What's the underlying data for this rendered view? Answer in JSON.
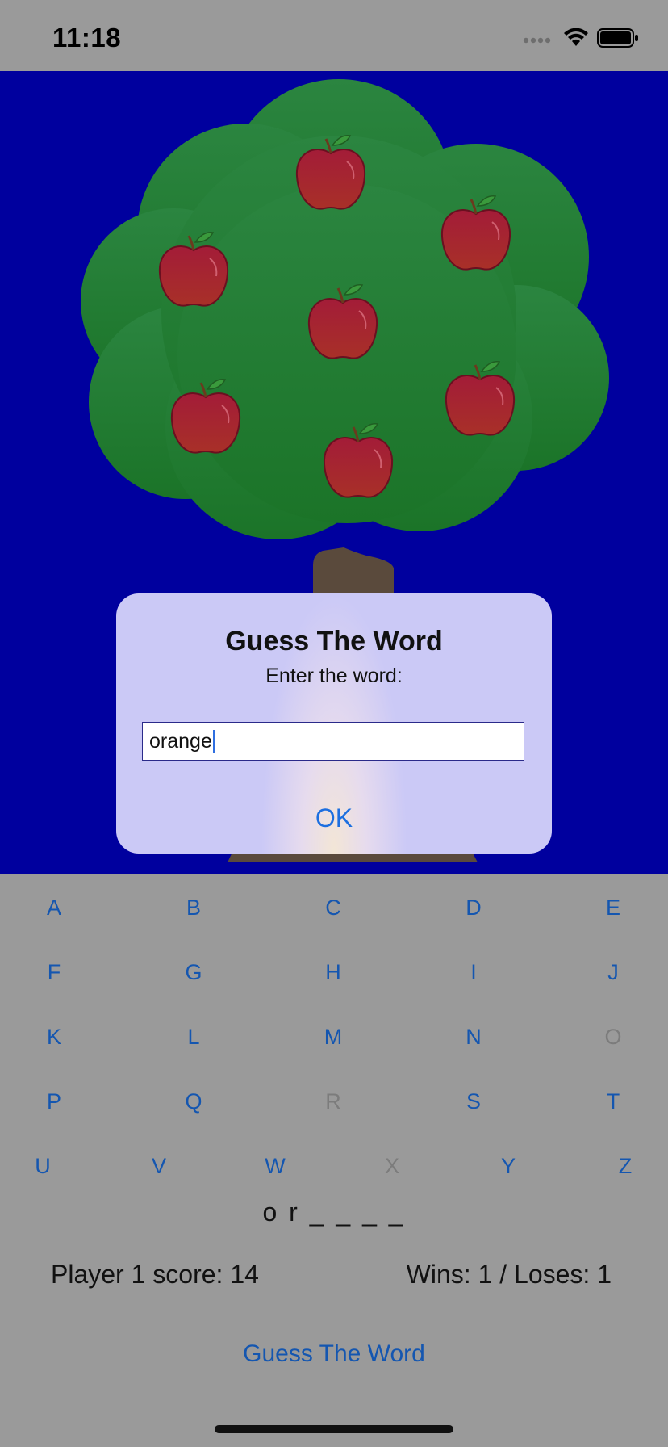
{
  "status_bar": {
    "time": "11:18"
  },
  "alert": {
    "title": "Guess The Word",
    "message": "Enter the word:",
    "input_value": "orange",
    "ok_label": "OK"
  },
  "keyboard": {
    "row1": [
      {
        "letter": "A",
        "enabled": true
      },
      {
        "letter": "B",
        "enabled": true
      },
      {
        "letter": "C",
        "enabled": true
      },
      {
        "letter": "D",
        "enabled": true
      },
      {
        "letter": "E",
        "enabled": true
      }
    ],
    "row2": [
      {
        "letter": "F",
        "enabled": true
      },
      {
        "letter": "G",
        "enabled": true
      },
      {
        "letter": "H",
        "enabled": true
      },
      {
        "letter": "I",
        "enabled": true
      },
      {
        "letter": "J",
        "enabled": true
      }
    ],
    "row3": [
      {
        "letter": "K",
        "enabled": true
      },
      {
        "letter": "L",
        "enabled": true
      },
      {
        "letter": "M",
        "enabled": true
      },
      {
        "letter": "N",
        "enabled": true
      },
      {
        "letter": "O",
        "enabled": false
      }
    ],
    "row4": [
      {
        "letter": "P",
        "enabled": true
      },
      {
        "letter": "Q",
        "enabled": true
      },
      {
        "letter": "R",
        "enabled": false
      },
      {
        "letter": "S",
        "enabled": true
      },
      {
        "letter": "T",
        "enabled": true
      }
    ],
    "row5": [
      {
        "letter": "U",
        "enabled": true
      },
      {
        "letter": "V",
        "enabled": true
      },
      {
        "letter": "W",
        "enabled": true
      },
      {
        "letter": "X",
        "enabled": false
      },
      {
        "letter": "Y",
        "enabled": true
      },
      {
        "letter": "Z",
        "enabled": true
      }
    ]
  },
  "game": {
    "word_display": "o r _ _ _ _",
    "score_text": "Player 1 score: 14",
    "record_text": "Wins: 1 / Loses: 1",
    "guess_button_label": "Guess The Word"
  },
  "colors": {
    "scene_bg": "#00009e",
    "tree_foliage": "#257a33",
    "apple": "#a42035",
    "key_enabled": "#1456b0",
    "key_disabled": "#7c7c7c"
  },
  "icons": [
    "cellular-signal-icon",
    "wifi-icon",
    "battery-icon",
    "apple-icon",
    "tree-trunk"
  ]
}
